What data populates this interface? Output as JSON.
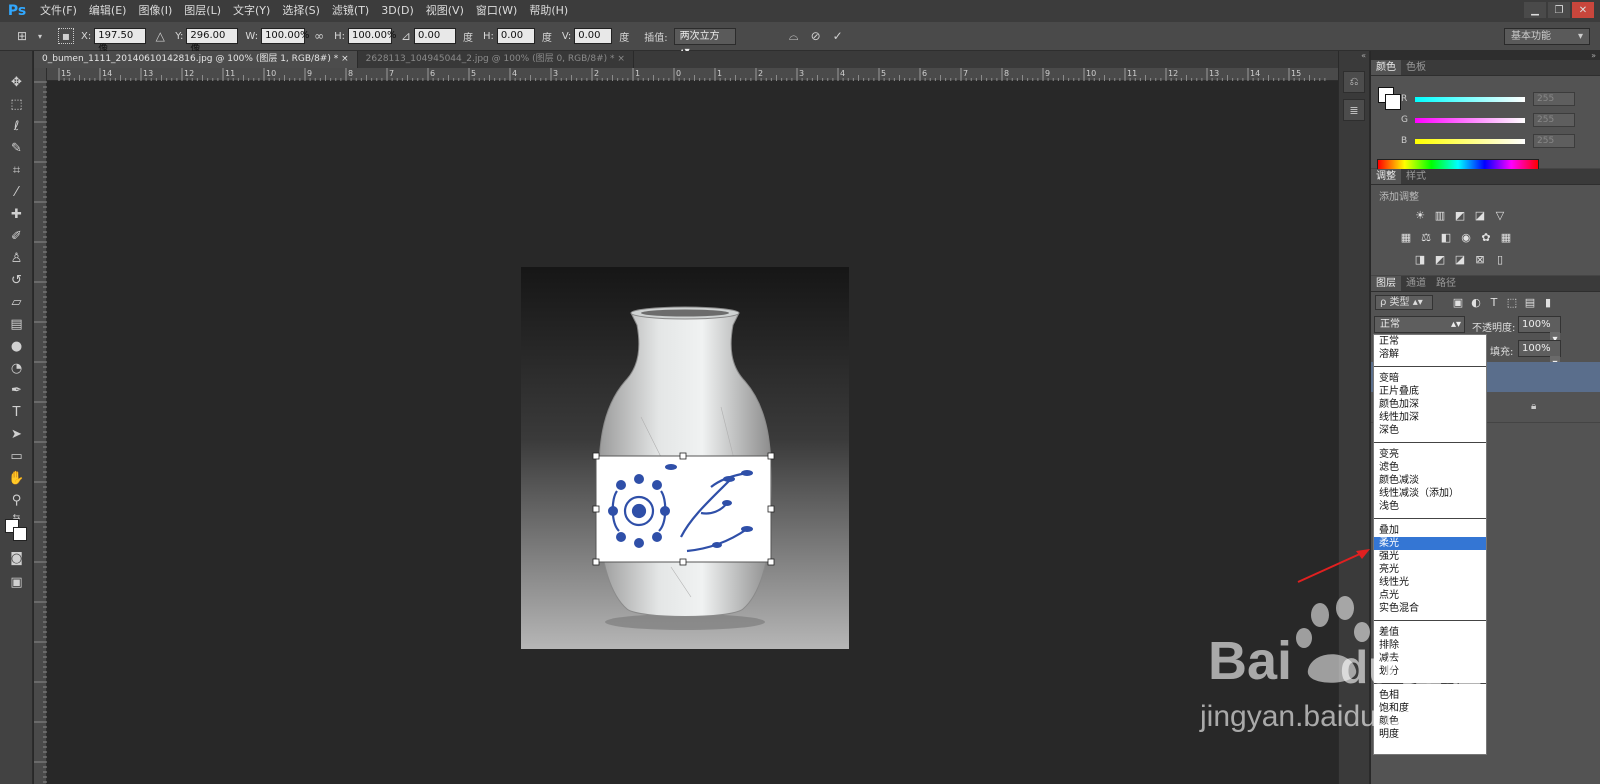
{
  "app": {
    "logo": "Ps"
  },
  "menu": [
    "文件(F)",
    "编辑(E)",
    "图像(I)",
    "图层(L)",
    "文字(Y)",
    "选择(S)",
    "滤镜(T)",
    "3D(D)",
    "视图(V)",
    "窗口(W)",
    "帮助(H)"
  ],
  "options": {
    "x_label": "X:",
    "x_value": "197.50 像",
    "y_label": "Y:",
    "y_value": "296.00 像",
    "w_label": "W:",
    "w_value": "100.00%",
    "h_label": "H:",
    "h_value": "100.00%",
    "angle_value": "0.00",
    "angle_unit": "度",
    "hskew_label": "H:",
    "hskew_value": "0.00",
    "hskew_unit": "度",
    "vskew_label": "V:",
    "vskew_value": "0.00",
    "vskew_unit": "度",
    "interp_label": "插值:",
    "interp_value": "两次立方",
    "workspace": "基本功能"
  },
  "tabs": [
    {
      "label": "0_bumen_1111_20140610142816.jpg @ 100% (图层 1, RGB/8#) *"
    },
    {
      "label": "2628113_104945044_2.jpg @ 100% (图层 0, RGB/8#) *"
    }
  ],
  "ruler_h_ticks": [
    "15",
    "14",
    "13",
    "12",
    "11",
    "10",
    "9",
    "8",
    "7",
    "6",
    "5",
    "4",
    "3",
    "2",
    "1",
    "0",
    "1",
    "2",
    "3",
    "4",
    "5",
    "6",
    "7",
    "8",
    "9",
    "10",
    "11",
    "12",
    "13",
    "14",
    "15"
  ],
  "color_panel": {
    "tabs": [
      "颜色",
      "色板"
    ],
    "r_label": "R",
    "r_value": "255",
    "g_label": "G",
    "g_value": "255",
    "b_label": "B",
    "b_value": "255"
  },
  "adjust_panel": {
    "tabs": [
      "调整",
      "样式"
    ],
    "title": "添加调整"
  },
  "layers_panel": {
    "tabs": [
      "图层",
      "通道",
      "路径"
    ],
    "filter": "ρ 类型",
    "blend_mode": "正常",
    "opacity_label": "不透明度:",
    "opacity_value": "100%",
    "fill_label": "填充:",
    "fill_value": "100%"
  },
  "blend_groups": [
    [
      "正常",
      "溶解"
    ],
    [
      "变暗",
      "正片叠底",
      "颜色加深",
      "线性加深",
      "深色"
    ],
    [
      "变亮",
      "滤色",
      "颜色减淡",
      "线性减淡（添加）",
      "浅色"
    ],
    [
      "叠加",
      "柔光",
      "强光",
      "亮光",
      "线性光",
      "点光",
      "实色混合"
    ],
    [
      "差值",
      "排除",
      "减去",
      "划分"
    ],
    [
      "色相",
      "饱和度",
      "颜色",
      "明度"
    ]
  ],
  "selected_blend": "柔光",
  "watermark": {
    "brand": "Bai",
    "du": "du",
    "cn": "经验",
    "url": "jingyan.baidu.com"
  },
  "colors": {
    "accent": "#3476d4",
    "arrow": "#e02020"
  }
}
